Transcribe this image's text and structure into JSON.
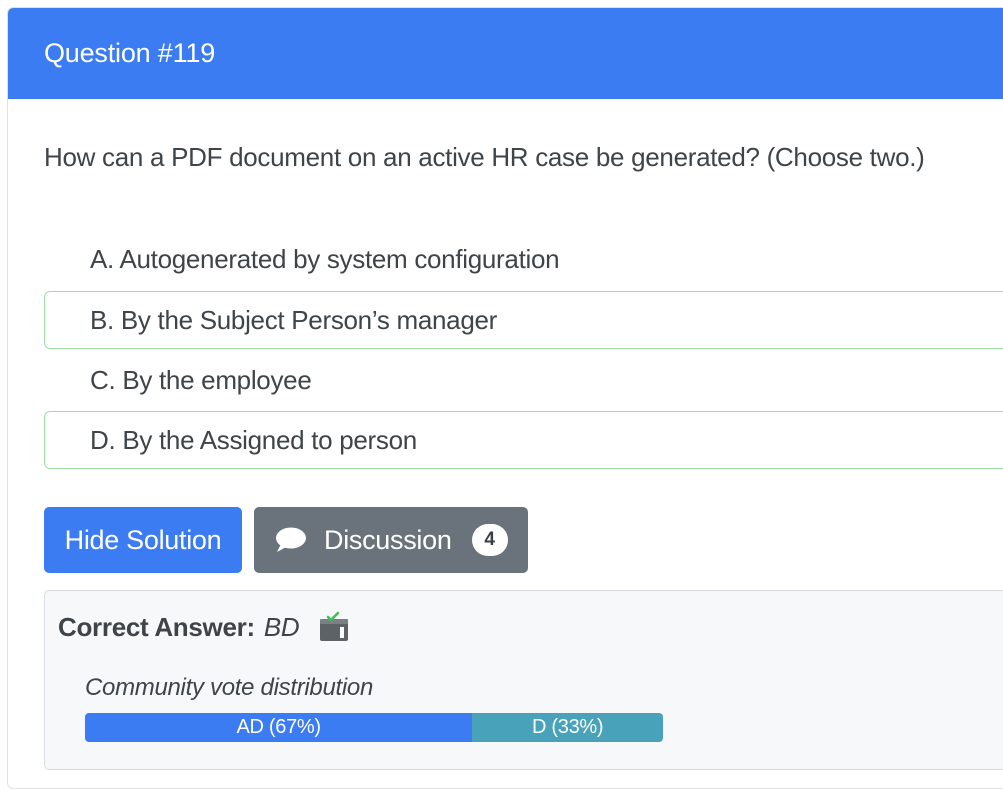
{
  "question": {
    "header": "Question #119",
    "text": "How can a PDF document on an active HR case be generated? (Choose two.)",
    "choices": [
      {
        "label": "A. Autogenerated by system configuration",
        "correct": false
      },
      {
        "label": "B. By the Subject Person’s manager",
        "correct": true
      },
      {
        "label": "C. By the employee",
        "correct": false
      },
      {
        "label": "D. By the Assigned to person",
        "correct": true
      }
    ]
  },
  "buttons": {
    "solution_label": "Hide Solution",
    "discussion_label": "Discussion",
    "discussion_count": "4",
    "discussion_icon": "chat-bubble-icon"
  },
  "answer": {
    "label": "Correct Answer:",
    "value": "BD",
    "reveal_icon": "reveal-solution-icon",
    "vote_label": "Community vote distribution",
    "votes": [
      {
        "label": "AD (67%)",
        "percent": 67,
        "color": "#3b7cf2"
      },
      {
        "label": "D (33%)",
        "percent": 33,
        "color": "#48a2b9"
      }
    ]
  },
  "colors": {
    "primary": "#3b7cf2",
    "secondary_button": "#6a737b",
    "correct_border": "#9fe0a6"
  }
}
